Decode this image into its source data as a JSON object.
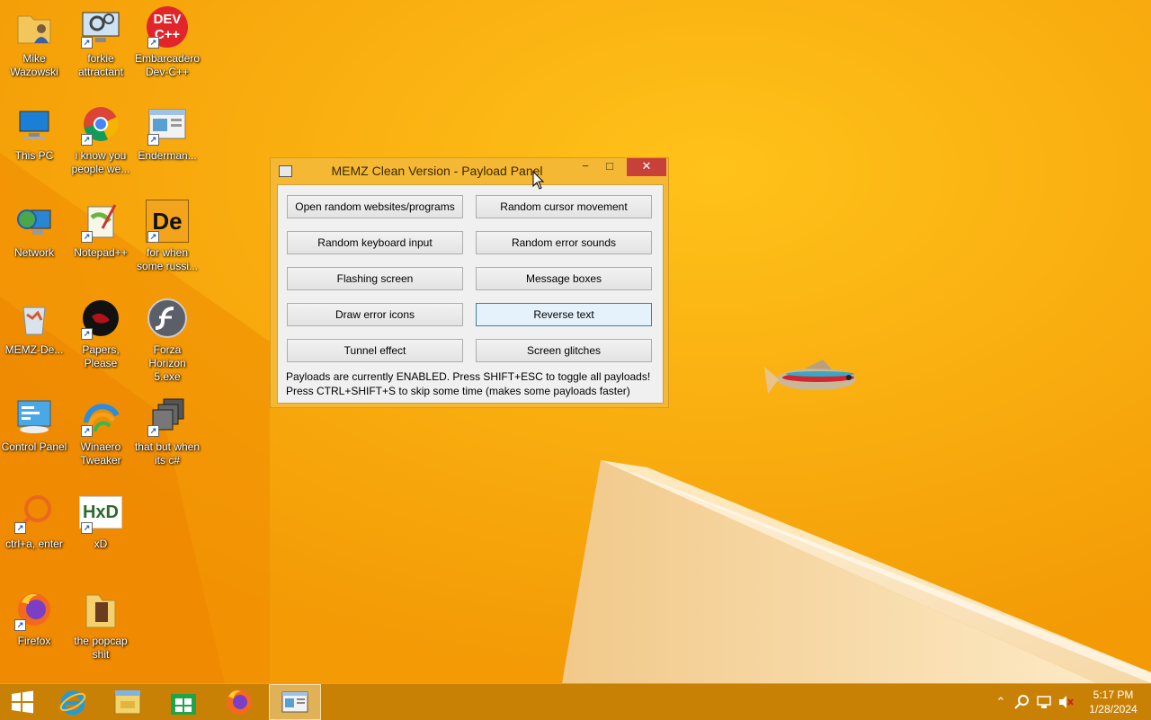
{
  "desktop": {
    "icons": [
      {
        "label": "Mike Wazowski",
        "icon": "folder-user-icon"
      },
      {
        "label": "forkie attractant",
        "icon": "computer-settings-icon"
      },
      {
        "label": "Embarcadero Dev-C++",
        "icon": "devcpp-icon"
      },
      {
        "label": "This PC",
        "icon": "this-pc-icon"
      },
      {
        "label": "i know you people we...",
        "icon": "chrome-icon"
      },
      {
        "label": "Enderman...",
        "icon": "window-app-icon"
      },
      {
        "label": "Network",
        "icon": "network-icon"
      },
      {
        "label": "Notepad++",
        "icon": "notepadpp-icon"
      },
      {
        "label": "for when some russi...",
        "icon": "de-app-icon"
      },
      {
        "label": "MEMZ-De...",
        "icon": "recycle-bin-icon"
      },
      {
        "label": "Papers, Please",
        "icon": "papers-please-icon"
      },
      {
        "label": "Forza Horizon 5.exe",
        "icon": "flash-icon"
      },
      {
        "label": "Control Panel",
        "icon": "control-panel-icon"
      },
      {
        "label": "Winaero Tweaker",
        "icon": "winaero-icon"
      },
      {
        "label": "that but when its c#",
        "icon": "stacked-windows-icon"
      },
      {
        "label": "ctrl+a, enter",
        "icon": "magnifier-ring-icon"
      },
      {
        "label": "xD",
        "icon": "hxd-icon"
      },
      {
        "label": "Firefox",
        "icon": "firefox-icon"
      },
      {
        "label": "the popcap shit",
        "icon": "folder-icon"
      }
    ],
    "devcpp_glyph": "DEV C++",
    "de_glyph": "De",
    "hxd_glyph": "HxD"
  },
  "window": {
    "title": "MEMZ Clean Version - Payload Panel",
    "buttons": [
      "Open random websites/programs",
      "Random cursor movement",
      "Random keyboard input",
      "Random error sounds",
      "Flashing screen",
      "Message boxes",
      "Draw error icons",
      "Reverse text",
      "Tunnel effect",
      "Screen glitches"
    ],
    "hovered_button": "Reverse text",
    "info_line1": "Payloads are currently ENABLED. Press SHIFT+ESC to toggle all payloads!",
    "info_line2": "Press CTRL+SHIFT+S to skip some time (makes some payloads faster)"
  },
  "taskbar": {
    "items": [
      {
        "icon": "windows-start-icon",
        "active": false
      },
      {
        "icon": "internet-explorer-icon",
        "active": false
      },
      {
        "icon": "file-explorer-icon",
        "active": false
      },
      {
        "icon": "store-icon",
        "active": false
      },
      {
        "icon": "firefox-icon",
        "active": false
      },
      {
        "icon": "memz-window-icon",
        "active": true
      }
    ],
    "tray_icons": [
      "tray-arrow-icon",
      "tray-search-icon",
      "network-tray-icon",
      "volume-muted-icon"
    ],
    "time": "5:17 PM",
    "date": "1/28/2024"
  },
  "colors": {
    "wallpaper": "#f7a70b",
    "taskbar": "#c47e04",
    "close_button": "#c7403a",
    "hover_button": "#e5f1fb"
  }
}
